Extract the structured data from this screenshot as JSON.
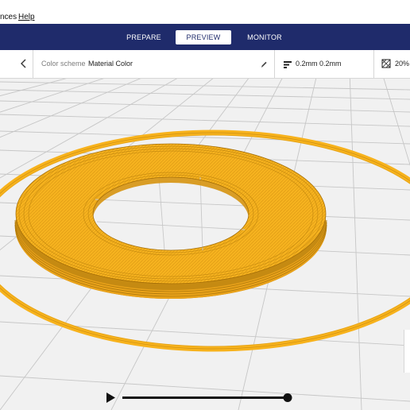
{
  "menu": {
    "items": [
      "nces",
      "Help"
    ]
  },
  "stage_tabs": [
    "PREPARE",
    "PREVIEW",
    "MONITOR"
  ],
  "active_tab": "PREVIEW",
  "toolbar": {
    "color_scheme_label": "Color scheme",
    "color_scheme_value": "Material Color",
    "layer_height": "0.2mm 0.2mm",
    "infill": "20%"
  },
  "colors": {
    "header": "#1f2b6b",
    "filament": "#f7b21c",
    "filament_dark": "#b77e0e",
    "grid": "#c4c4c4",
    "plate": "#f1f1f1"
  },
  "icons": [
    "back-chevron-icon",
    "edit-pencil-icon",
    "layer-height-icon",
    "infill-icon",
    "play-icon"
  ],
  "layer_slider": {
    "position": 0.95
  }
}
